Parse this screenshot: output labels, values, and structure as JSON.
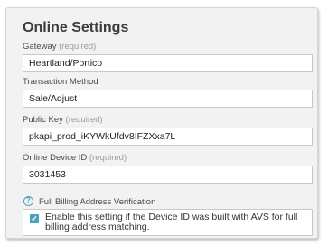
{
  "panel": {
    "title": "Online Settings"
  },
  "fields": {
    "gateway": {
      "label": "Gateway",
      "required": "(required)",
      "value": "Heartland/Portico"
    },
    "transaction_method": {
      "label": "Transaction Method",
      "value": "Sale/Adjust"
    },
    "public_key": {
      "label": "Public Key",
      "required": "(required)",
      "value": "pkapi_prod_iKYWkUfdv8IFZXxa7L"
    },
    "online_device_id": {
      "label": "Online Device ID",
      "required": "(required)",
      "value": "3031453"
    }
  },
  "avs": {
    "help_icon": "question-circle-icon",
    "label": "Full Billing Address Verification",
    "checked": true,
    "check_icon": "checkmark-icon",
    "description": "Enable this setting if the Device ID was built with AVS for full billing address matching."
  },
  "colors": {
    "accent": "#4ba3b9",
    "panel_bg": "#f2f2f2",
    "required_text": "#9a9a9a"
  }
}
